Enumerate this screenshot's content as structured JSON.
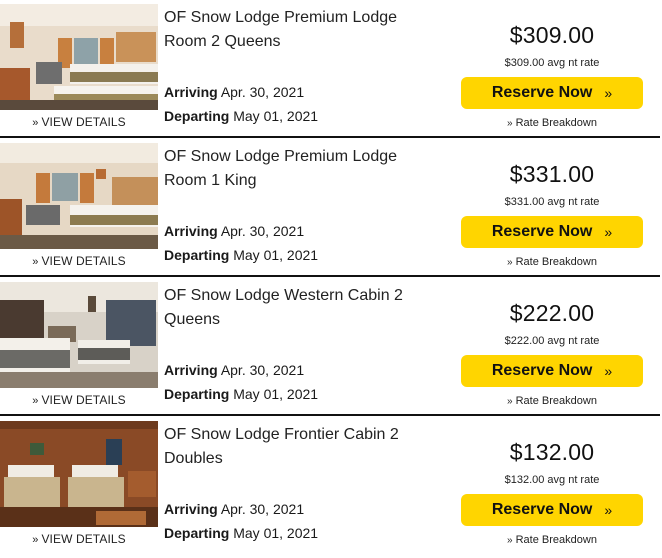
{
  "colors": {
    "accent": "#ffd500",
    "divider": "#111111"
  },
  "rooms": [
    {
      "name": "OF Snow Lodge Premium Lodge Room 2 Queens",
      "view_details": "VIEW DETAILS",
      "arriving_label": "Arriving",
      "arriving_date": "Apr. 30, 2021",
      "departing_label": "Departing",
      "departing_date": "May 01, 2021",
      "price": "$309.00",
      "avg_rate": "$309.00 avg nt rate",
      "reserve_label": "Reserve Now",
      "breakdown_label": "Rate Breakdown"
    },
    {
      "name": "OF Snow Lodge Premium Lodge Room 1 King",
      "view_details": "VIEW DETAILS",
      "arriving_label": "Arriving",
      "arriving_date": "Apr. 30, 2021",
      "departing_label": "Departing",
      "departing_date": "May 01, 2021",
      "price": "$331.00",
      "avg_rate": "$331.00 avg nt rate",
      "reserve_label": "Reserve Now",
      "breakdown_label": "Rate Breakdown"
    },
    {
      "name": "OF Snow Lodge Western Cabin 2 Queens",
      "view_details": "VIEW DETAILS",
      "arriving_label": "Arriving",
      "arriving_date": "Apr. 30, 2021",
      "departing_label": "Departing",
      "departing_date": "May 01, 2021",
      "price": "$222.00",
      "avg_rate": "$222.00 avg nt rate",
      "reserve_label": "Reserve Now",
      "breakdown_label": "Rate Breakdown"
    },
    {
      "name": "OF Snow Lodge Frontier Cabin 2 Doubles",
      "view_details": "VIEW DETAILS",
      "arriving_label": "Arriving",
      "arriving_date": "Apr. 30, 2021",
      "departing_label": "Departing",
      "departing_date": "May 01, 2021",
      "price": "$132.00",
      "avg_rate": "$132.00 avg nt rate",
      "reserve_label": "Reserve Now",
      "breakdown_label": "Rate Breakdown"
    }
  ]
}
